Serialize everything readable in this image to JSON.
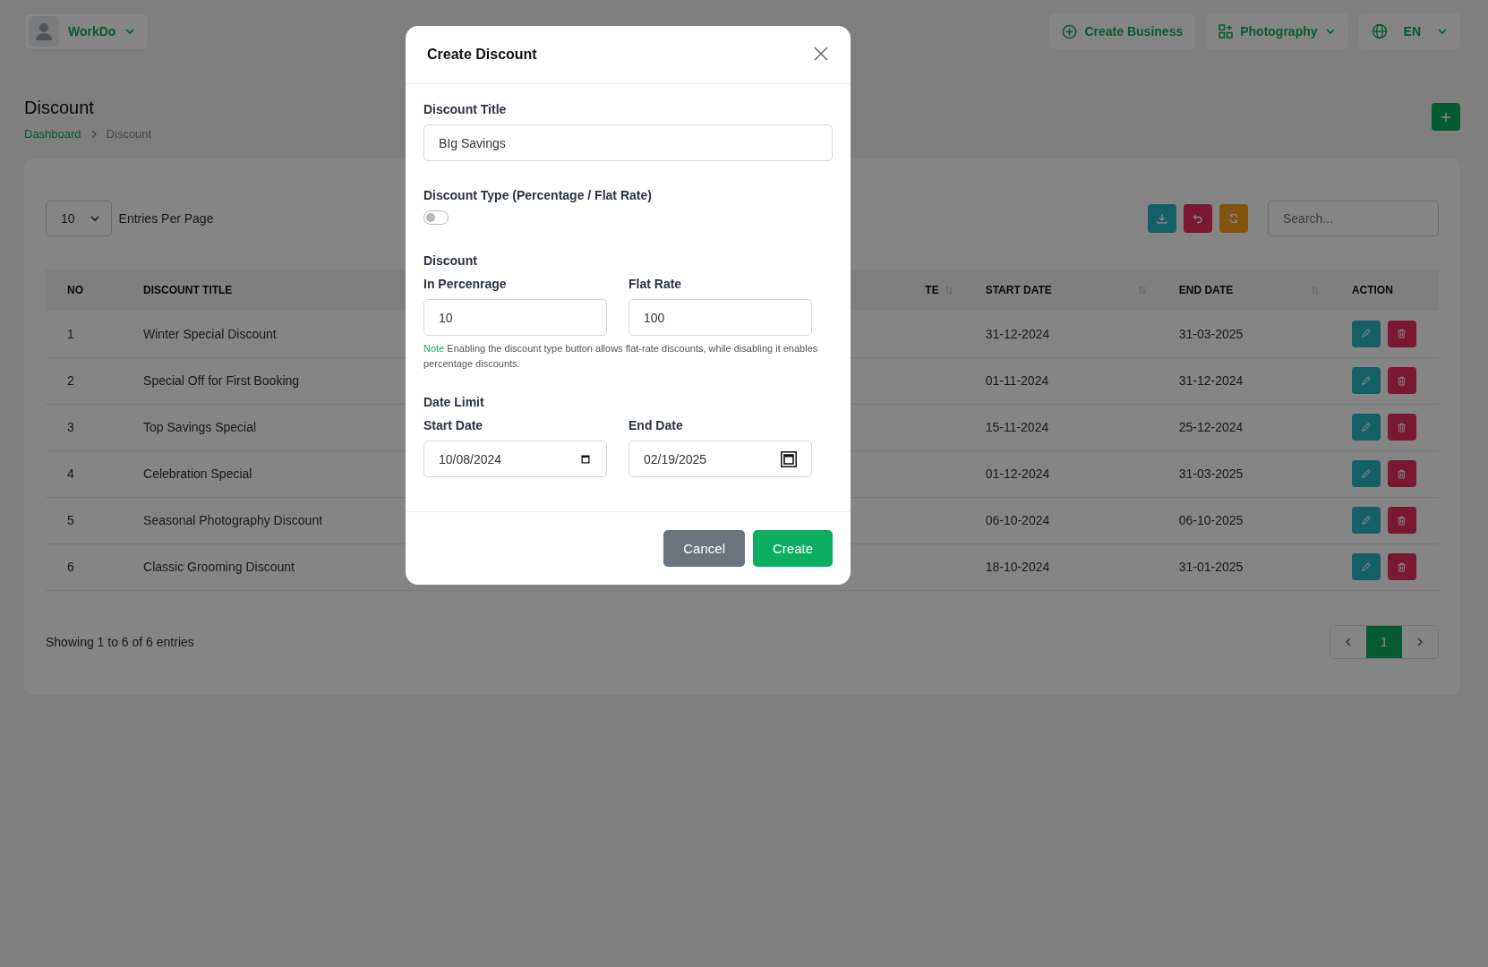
{
  "header": {
    "user": {
      "name": "WorkDo"
    },
    "actions": [
      {
        "kind": "create",
        "label": "Create Business"
      },
      {
        "kind": "workspace",
        "label": "Photography"
      },
      {
        "kind": "language",
        "label": "EN"
      }
    ]
  },
  "page": {
    "title": "Discount",
    "breadcrumbs": [
      {
        "label": "Dashboard",
        "current": false
      },
      {
        "label": "Discount",
        "current": true
      }
    ]
  },
  "toolbar": {
    "entries_per_page": "10",
    "entries_label": "Entries Per Page",
    "buttons": [
      {
        "kind": "export"
      },
      {
        "kind": "reset"
      },
      {
        "kind": "reload"
      }
    ],
    "search": {
      "placeholder": "Search..."
    }
  },
  "table": {
    "columns": [
      {
        "label": "NO",
        "sortable": false
      },
      {
        "label": "DISCOUNT TITLE"
      },
      {
        "label": "TE",
        "sortable": true
      },
      {
        "label": "START DATE",
        "sortable": true
      },
      {
        "label": "END DATE",
        "sortable": true
      },
      {
        "label": "ACTION",
        "sortable": false
      }
    ],
    "rows": [
      {
        "no": "1",
        "title": "Winter Special Discount",
        "start": "31-12-2024",
        "end": "31-03-2025"
      },
      {
        "no": "2",
        "title": "Special Off for First Booking",
        "start": "01-11-2024",
        "end": "31-12-2024"
      },
      {
        "no": "3",
        "title": "Top Savings Special",
        "start": "15-11-2024",
        "end": "25-12-2024"
      },
      {
        "no": "4",
        "title": "Celebration Special",
        "start": "01-12-2024",
        "end": "31-03-2025"
      },
      {
        "no": "5",
        "title": "Seasonal Photography Discount",
        "start": "06-10-2024",
        "end": "06-10-2025"
      },
      {
        "no": "6",
        "title": "Classic Grooming Discount",
        "start": "18-10-2024",
        "end": "31-01-2025"
      }
    ]
  },
  "footer": {
    "summary": "Showing 1 to 6 of 6 entries",
    "pages": [
      {
        "label": "1",
        "selected": true
      }
    ]
  },
  "modal": {
    "title": "Create Discount",
    "title_field": {
      "label": "Discount Title",
      "value": "BIg Savings"
    },
    "type_toggle": {
      "label": "Discount Type (Percentage / Flat Rate)",
      "on": false
    },
    "discount": {
      "heading": "Discount",
      "fields": [
        {
          "label": "In Percenrage",
          "value": "10"
        },
        {
          "label": "Flat Rate",
          "value": "100"
        }
      ]
    },
    "note": {
      "label": "Note",
      "text": "Enabling the discount type button allows flat-rate discounts, while disabling it enables percentage discounts."
    },
    "dates": {
      "heading": "Date Limit",
      "fields": [
        {
          "label": "Start Date",
          "value": "10/08/2024"
        },
        {
          "label": "End Date",
          "value": "02/19/2025"
        }
      ]
    },
    "buttons": [
      {
        "kind": "cancel",
        "label": "Cancel"
      },
      {
        "kind": "primary",
        "label": "Create"
      }
    ]
  }
}
